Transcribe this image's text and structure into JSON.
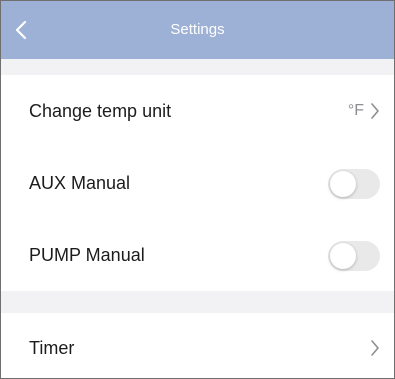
{
  "header": {
    "title": "Settings",
    "back_icon": "chevron-left-icon",
    "background": "#9db0d6"
  },
  "settings": {
    "change_temp_unit": {
      "label": "Change temp unit",
      "value": "°F"
    },
    "aux_manual": {
      "label": "AUX Manual",
      "enabled": false
    },
    "pump_manual": {
      "label": "PUMP Manual",
      "enabled": false
    },
    "timer": {
      "label": "Timer"
    }
  },
  "icons": {
    "row_disclosure": "chevron-right-icon"
  },
  "colors": {
    "section_gap": "#f2f2f4",
    "toggle_off": "#e9e9ea",
    "secondary_text": "#8e8e93"
  }
}
